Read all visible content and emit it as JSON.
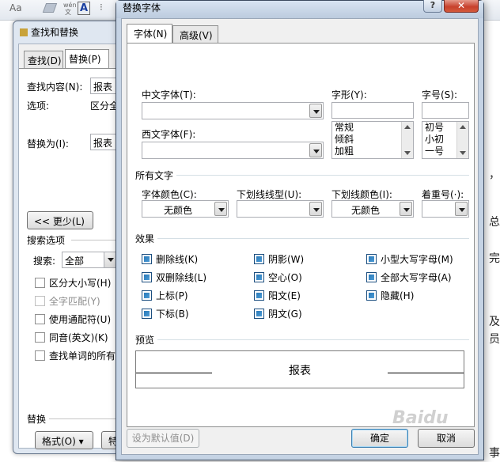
{
  "ribbon": {
    "font_size_label": "Aa",
    "wen_label": "wén\n文",
    "big_a_label": "A"
  },
  "background_doc": {
    "right_chars": [
      "，",
      "总",
      "完",
      "及",
      "员",
      "事"
    ]
  },
  "find_replace": {
    "title": "查找和替换",
    "tab_find": "查找(D)",
    "tab_replace": "替换(P)",
    "find_label": "查找内容(N):",
    "find_value": "报表",
    "options_label": "选项:",
    "options_value": "区分全",
    "replace_label": "替换为(I):",
    "replace_value": "报表",
    "less_button": "<< 更少(L)",
    "search_options_section": "搜索选项",
    "search_label": "搜索:",
    "search_value": "全部",
    "checkboxes": [
      {
        "label": "区分大小写(H)",
        "disabled": false
      },
      {
        "label": "全字匹配(Y)",
        "disabled": true
      },
      {
        "label": "使用通配符(U)",
        "disabled": false
      },
      {
        "label": "同音(英文)(K)",
        "disabled": false
      },
      {
        "label": "查找单词的所有",
        "disabled": false
      }
    ],
    "replace_section": "替换",
    "format_button": "格式(O) ▾",
    "special_button_partial": "特"
  },
  "font_dialog": {
    "title": "替换字体",
    "help_glyph": "?",
    "close_glyph": "✕",
    "tabs": [
      "字体(N)",
      "高级(V)"
    ],
    "chinese_font_label": "中文字体(T):",
    "chinese_font_value": "",
    "western_font_label": "西文字体(F):",
    "western_font_value": "",
    "style_label": "字形(Y):",
    "style_value": "",
    "style_items": [
      "常规",
      "倾斜",
      "加粗"
    ],
    "size_label": "字号(S):",
    "size_value": "",
    "size_items": [
      "初号",
      "小初",
      "一号"
    ],
    "all_text_section": "所有文字",
    "font_color_label": "字体颜色(C):",
    "font_color_value": "无颜色",
    "underline_style_label": "下划线线型(U):",
    "underline_style_value": "",
    "underline_color_label": "下划线颜色(I):",
    "underline_color_value": "无颜色",
    "emphasis_label": "着重号(·):",
    "emphasis_value": "",
    "effects_section": "效果",
    "effects": [
      [
        "删除线(K)",
        "双删除线(L)",
        "上标(P)",
        "下标(B)"
      ],
      [
        "阴影(W)",
        "空心(O)",
        "阳文(E)",
        "阴文(G)"
      ],
      [
        "小型大写字母(M)",
        "全部大写字母(A)",
        "隐藏(H)"
      ]
    ],
    "preview_section": "预览",
    "preview_text": "报表",
    "set_default_button": "设为默认值(D)",
    "ok_button": "确定",
    "cancel_button": "取消"
  },
  "watermark": "Baidu"
}
